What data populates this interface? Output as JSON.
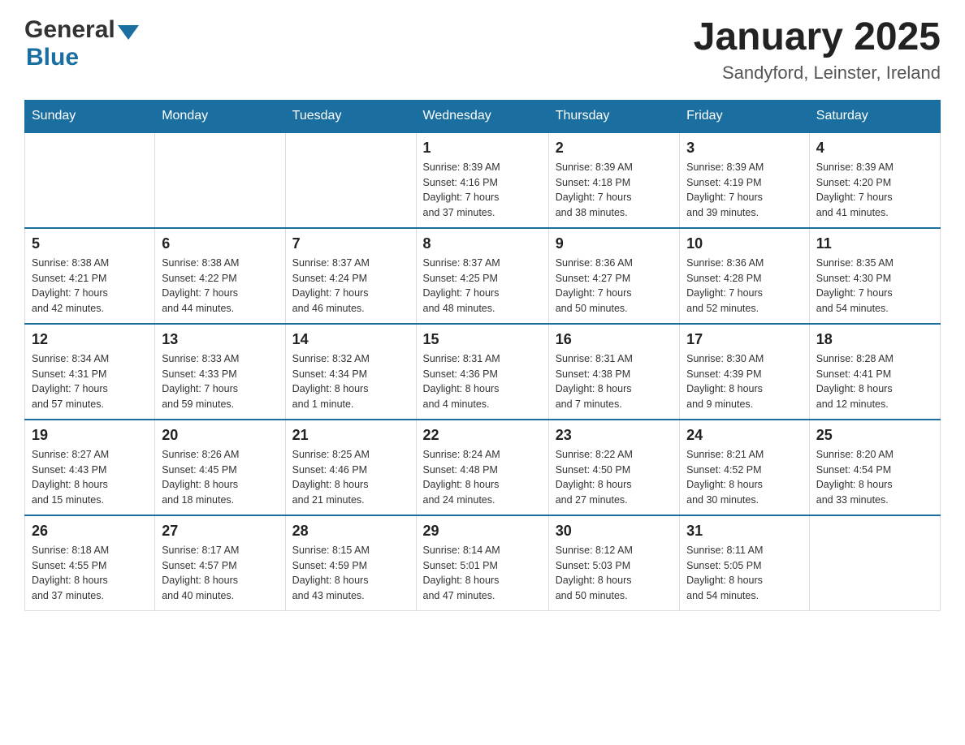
{
  "header": {
    "logo_general": "General",
    "logo_blue": "Blue",
    "title": "January 2025",
    "subtitle": "Sandyford, Leinster, Ireland"
  },
  "weekdays": [
    "Sunday",
    "Monday",
    "Tuesday",
    "Wednesday",
    "Thursday",
    "Friday",
    "Saturday"
  ],
  "weeks": [
    [
      {
        "day": "",
        "info": ""
      },
      {
        "day": "",
        "info": ""
      },
      {
        "day": "",
        "info": ""
      },
      {
        "day": "1",
        "info": "Sunrise: 8:39 AM\nSunset: 4:16 PM\nDaylight: 7 hours\nand 37 minutes."
      },
      {
        "day": "2",
        "info": "Sunrise: 8:39 AM\nSunset: 4:18 PM\nDaylight: 7 hours\nand 38 minutes."
      },
      {
        "day": "3",
        "info": "Sunrise: 8:39 AM\nSunset: 4:19 PM\nDaylight: 7 hours\nand 39 minutes."
      },
      {
        "day": "4",
        "info": "Sunrise: 8:39 AM\nSunset: 4:20 PM\nDaylight: 7 hours\nand 41 minutes."
      }
    ],
    [
      {
        "day": "5",
        "info": "Sunrise: 8:38 AM\nSunset: 4:21 PM\nDaylight: 7 hours\nand 42 minutes."
      },
      {
        "day": "6",
        "info": "Sunrise: 8:38 AM\nSunset: 4:22 PM\nDaylight: 7 hours\nand 44 minutes."
      },
      {
        "day": "7",
        "info": "Sunrise: 8:37 AM\nSunset: 4:24 PM\nDaylight: 7 hours\nand 46 minutes."
      },
      {
        "day": "8",
        "info": "Sunrise: 8:37 AM\nSunset: 4:25 PM\nDaylight: 7 hours\nand 48 minutes."
      },
      {
        "day": "9",
        "info": "Sunrise: 8:36 AM\nSunset: 4:27 PM\nDaylight: 7 hours\nand 50 minutes."
      },
      {
        "day": "10",
        "info": "Sunrise: 8:36 AM\nSunset: 4:28 PM\nDaylight: 7 hours\nand 52 minutes."
      },
      {
        "day": "11",
        "info": "Sunrise: 8:35 AM\nSunset: 4:30 PM\nDaylight: 7 hours\nand 54 minutes."
      }
    ],
    [
      {
        "day": "12",
        "info": "Sunrise: 8:34 AM\nSunset: 4:31 PM\nDaylight: 7 hours\nand 57 minutes."
      },
      {
        "day": "13",
        "info": "Sunrise: 8:33 AM\nSunset: 4:33 PM\nDaylight: 7 hours\nand 59 minutes."
      },
      {
        "day": "14",
        "info": "Sunrise: 8:32 AM\nSunset: 4:34 PM\nDaylight: 8 hours\nand 1 minute."
      },
      {
        "day": "15",
        "info": "Sunrise: 8:31 AM\nSunset: 4:36 PM\nDaylight: 8 hours\nand 4 minutes."
      },
      {
        "day": "16",
        "info": "Sunrise: 8:31 AM\nSunset: 4:38 PM\nDaylight: 8 hours\nand 7 minutes."
      },
      {
        "day": "17",
        "info": "Sunrise: 8:30 AM\nSunset: 4:39 PM\nDaylight: 8 hours\nand 9 minutes."
      },
      {
        "day": "18",
        "info": "Sunrise: 8:28 AM\nSunset: 4:41 PM\nDaylight: 8 hours\nand 12 minutes."
      }
    ],
    [
      {
        "day": "19",
        "info": "Sunrise: 8:27 AM\nSunset: 4:43 PM\nDaylight: 8 hours\nand 15 minutes."
      },
      {
        "day": "20",
        "info": "Sunrise: 8:26 AM\nSunset: 4:45 PM\nDaylight: 8 hours\nand 18 minutes."
      },
      {
        "day": "21",
        "info": "Sunrise: 8:25 AM\nSunset: 4:46 PM\nDaylight: 8 hours\nand 21 minutes."
      },
      {
        "day": "22",
        "info": "Sunrise: 8:24 AM\nSunset: 4:48 PM\nDaylight: 8 hours\nand 24 minutes."
      },
      {
        "day": "23",
        "info": "Sunrise: 8:22 AM\nSunset: 4:50 PM\nDaylight: 8 hours\nand 27 minutes."
      },
      {
        "day": "24",
        "info": "Sunrise: 8:21 AM\nSunset: 4:52 PM\nDaylight: 8 hours\nand 30 minutes."
      },
      {
        "day": "25",
        "info": "Sunrise: 8:20 AM\nSunset: 4:54 PM\nDaylight: 8 hours\nand 33 minutes."
      }
    ],
    [
      {
        "day": "26",
        "info": "Sunrise: 8:18 AM\nSunset: 4:55 PM\nDaylight: 8 hours\nand 37 minutes."
      },
      {
        "day": "27",
        "info": "Sunrise: 8:17 AM\nSunset: 4:57 PM\nDaylight: 8 hours\nand 40 minutes."
      },
      {
        "day": "28",
        "info": "Sunrise: 8:15 AM\nSunset: 4:59 PM\nDaylight: 8 hours\nand 43 minutes."
      },
      {
        "day": "29",
        "info": "Sunrise: 8:14 AM\nSunset: 5:01 PM\nDaylight: 8 hours\nand 47 minutes."
      },
      {
        "day": "30",
        "info": "Sunrise: 8:12 AM\nSunset: 5:03 PM\nDaylight: 8 hours\nand 50 minutes."
      },
      {
        "day": "31",
        "info": "Sunrise: 8:11 AM\nSunset: 5:05 PM\nDaylight: 8 hours\nand 54 minutes."
      },
      {
        "day": "",
        "info": ""
      }
    ]
  ]
}
